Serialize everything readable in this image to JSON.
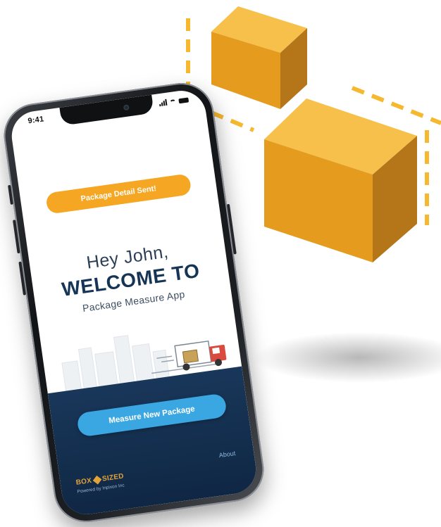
{
  "status_bar": {
    "time": "9:41"
  },
  "toast": {
    "text": "Package Detail Sent!"
  },
  "welcome": {
    "greeting": "Hey John,",
    "title": "WELCOME TO",
    "app_name": "Package Measure App"
  },
  "actions": {
    "measure_button": "Measure New Package"
  },
  "footer": {
    "logo_part1": "BOX",
    "logo_part2": "SIZED",
    "powered_by": "Powered by Inpixon Inc",
    "about": "About"
  },
  "colors": {
    "accent_orange": "#f5a623",
    "button_blue": "#3aa7e2",
    "panel_navy": "#163556",
    "cube_top": "#f6c04a",
    "cube_left": "#e49b1e",
    "cube_right": "#b5761a"
  },
  "icons": [
    "signal-icon",
    "wifi-icon",
    "battery-icon",
    "delivery-truck-icon",
    "box-cube-icon"
  ]
}
